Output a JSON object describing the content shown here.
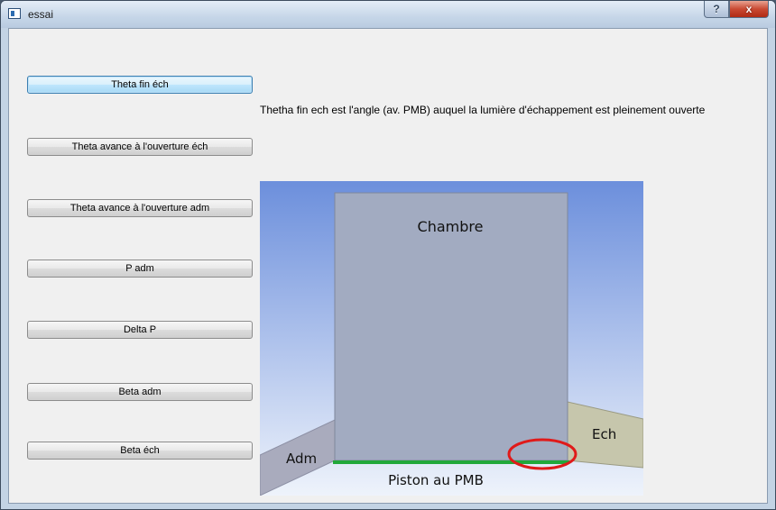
{
  "window": {
    "title": "essai",
    "help_glyph": "?",
    "close_glyph": "x"
  },
  "buttons": [
    {
      "label": "Theta fin éch",
      "focused": true
    },
    {
      "label": "Theta avance à l'ouverture éch",
      "focused": false
    },
    {
      "label": "Theta avance à l'ouverture adm",
      "focused": false
    },
    {
      "label": "P adm",
      "focused": false
    },
    {
      "label": "Delta P",
      "focused": false
    },
    {
      "label": "Beta adm",
      "focused": false
    },
    {
      "label": "Beta éch",
      "focused": false
    }
  ],
  "description": "Thetha fin ech est l'angle (av. PMB) auquel la lumière d'échappement est pleinement ouverte",
  "diagram": {
    "chamber_label": "Chambre",
    "intake_label": "Adm",
    "exhaust_label": "Ech",
    "piston_label": "Piston au PMB",
    "colors": {
      "background_top": "#6c8fdc",
      "background_bottom": "#eef3fb",
      "chamber": "#a2abc1",
      "intake_port": "#a9abbd",
      "exhaust_port": "#c6c6ac",
      "piston_line": "#22a83a",
      "highlight_ellipse": "#e01a1a"
    }
  }
}
